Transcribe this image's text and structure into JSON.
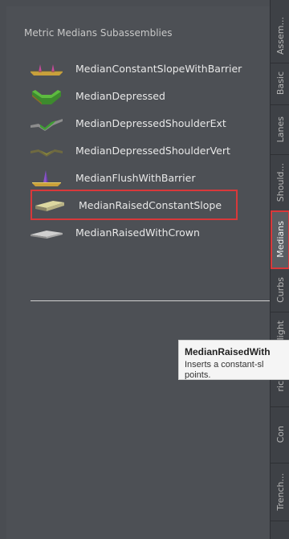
{
  "palette": {
    "title": "Metric Medians Subassemblies",
    "items": [
      {
        "label": "MedianConstantSlopeWithBarrier",
        "icon": "median-barrier-icon"
      },
      {
        "label": "MedianDepressed",
        "icon": "median-depressed-icon"
      },
      {
        "label": "MedianDepressedShoulderExt",
        "icon": "median-depressed-shoulder-ext-icon"
      },
      {
        "label": "MedianDepressedShoulderVert",
        "icon": "median-depressed-shoulder-vert-icon"
      },
      {
        "label": "MedianFlushWithBarrier",
        "icon": "median-flush-barrier-icon"
      },
      {
        "label": "MedianRaisedConstantSlope",
        "icon": "median-raised-slope-icon",
        "selected": true
      },
      {
        "label": "MedianRaisedWithCrown",
        "icon": "median-raised-crown-icon"
      }
    ]
  },
  "tabs": [
    {
      "label": "Assem..."
    },
    {
      "label": "Basic"
    },
    {
      "label": "Lanes"
    },
    {
      "label": "Should..."
    },
    {
      "label": "Medians",
      "active": true
    },
    {
      "label": "Curbs"
    },
    {
      "label": "Daylight"
    },
    {
      "label": "ric"
    },
    {
      "label": "Con"
    },
    {
      "label": "Trench..."
    }
  ],
  "tooltip": {
    "title": "MedianRaisedWith",
    "body_line1": "Inserts a constant-sl",
    "body_line2": "points."
  },
  "colors": {
    "panel_bg": "#4d5055",
    "highlight": "#d9383a"
  }
}
